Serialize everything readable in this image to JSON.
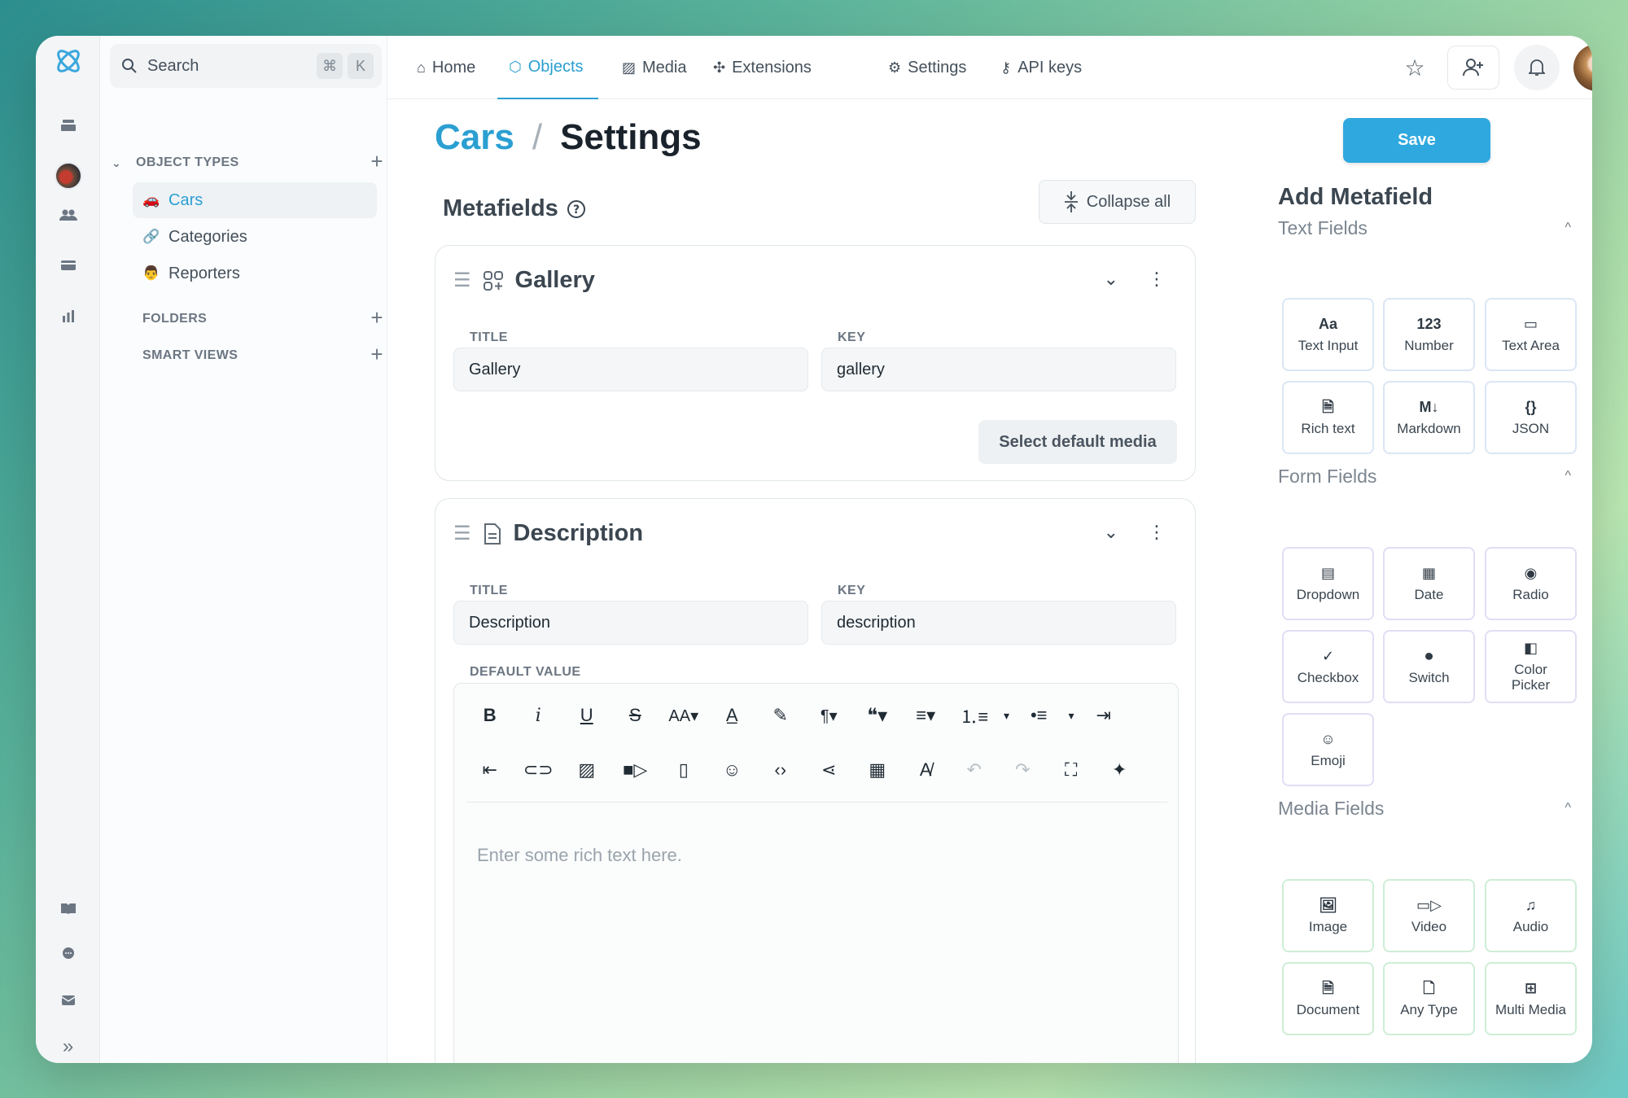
{
  "search": {
    "placeholder": "Search",
    "kbd1": "⌘",
    "kbd2": "K"
  },
  "sidebar": {
    "object_types_label": "OBJECT TYPES",
    "objects": [
      {
        "label": "Cars",
        "emoji": "🚗"
      },
      {
        "label": "Categories",
        "emoji": "🔗"
      },
      {
        "label": "Reporters",
        "emoji": "👨"
      }
    ],
    "folders_label": "FOLDERS",
    "smart_views_label": "SMART VIEWS"
  },
  "nav": {
    "home": "Home",
    "objects": "Objects",
    "media": "Media",
    "extensions": "Extensions",
    "settings": "Settings",
    "api_keys": "API keys"
  },
  "breadcrumb": {
    "object": "Cars",
    "separator": "/",
    "page": "Settings"
  },
  "save_label": "Save",
  "metafields": {
    "title": "Metafields",
    "collapse_label": "Collapse all",
    "gallery": {
      "name": "Gallery",
      "title_label": "TITLE",
      "title_value": "Gallery",
      "key_label": "KEY",
      "key_value": "gallery",
      "select_media_label": "Select default media"
    },
    "description": {
      "name": "Description",
      "title_label": "TITLE",
      "title_value": "Description",
      "key_label": "KEY",
      "key_value": "description",
      "default_label": "DEFAULT VALUE",
      "placeholder": "Enter some rich text here."
    }
  },
  "add_panel": {
    "title": "Add Metafield",
    "text_fields": {
      "label": "Text Fields",
      "items": [
        {
          "label": "Text Input",
          "icon": "Aa"
        },
        {
          "label": "Number",
          "icon": "123"
        },
        {
          "label": "Text Area",
          "icon": "▭"
        },
        {
          "label": "Rich text",
          "icon": "🗎"
        },
        {
          "label": "Markdown",
          "icon": "M↓"
        },
        {
          "label": "JSON",
          "icon": "{}"
        }
      ]
    },
    "form_fields": {
      "label": "Form Fields",
      "items": [
        {
          "label": "Dropdown",
          "icon": "▤"
        },
        {
          "label": "Date",
          "icon": "▦"
        },
        {
          "label": "Radio",
          "icon": "◉"
        },
        {
          "label": "Checkbox",
          "icon": "✓"
        },
        {
          "label": "Switch",
          "icon": "⏺"
        },
        {
          "label": "Color Picker",
          "icon": "◧"
        },
        {
          "label": "Emoji",
          "icon": "☺"
        }
      ]
    },
    "media_fields": {
      "label": "Media Fields",
      "items": [
        {
          "label": "Image",
          "icon": "🖼"
        },
        {
          "label": "Video",
          "icon": "▭▷"
        },
        {
          "label": "Audio",
          "icon": "♫"
        },
        {
          "label": "Document",
          "icon": "🗎"
        },
        {
          "label": "Any Type",
          "icon": "🗋"
        },
        {
          "label": "Multi Media",
          "icon": "⊞"
        }
      ]
    }
  },
  "colors": {
    "accent": "#2fa8df",
    "text_tile_border": "#dbe6f5",
    "form_tile_border": "#e2ddf5",
    "media_tile_border": "#cdeed6"
  }
}
